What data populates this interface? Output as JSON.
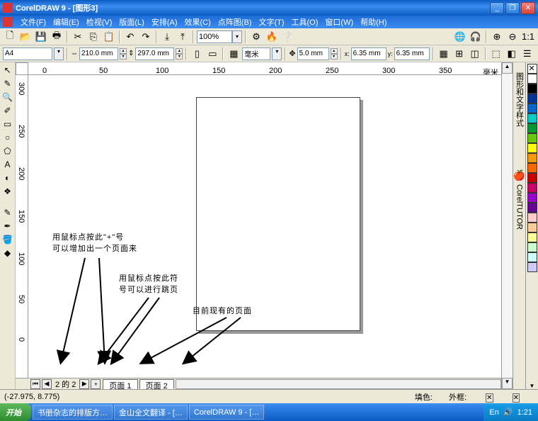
{
  "title": "CorelDRAW 9 - [图形3]",
  "menus": [
    "文件(F)",
    "编辑(E)",
    "检视(V)",
    "版面(L)",
    "安排(A)",
    "效果(C)",
    "点阵图(B)",
    "文字(T)",
    "工具(O)",
    "窗口(W)",
    "帮助(H)"
  ],
  "toolbar1": {
    "zoom_value": "100%"
  },
  "propbar": {
    "paper": "A4",
    "width": "210.0 mm",
    "height": "297.0 mm",
    "unit": "毫米",
    "nudge": "5.0 mm",
    "dup_x": "6.35 mm",
    "dup_y": "6.35 mm"
  },
  "ruler_h_ticks": [
    "0",
    "50",
    "100",
    "150",
    "200",
    "250",
    "300",
    "350"
  ],
  "ruler_h_unit": "毫米",
  "ruler_v_ticks": [
    "300",
    "250",
    "200",
    "150",
    "100",
    "50",
    "0"
  ],
  "annotations": {
    "a1_line1": "用鼠标点按此\"+\"号",
    "a1_line2": "可以增加出一个页面来",
    "a2_line1": "用鼠标点按此符",
    "a2_line2": "号可以进行跳页",
    "a3": "目前现有的页面"
  },
  "page_tabs": {
    "counter": "2 的 2",
    "tab1": "页面  1",
    "tab2": "页面  2"
  },
  "status": {
    "coords": "(-27.975, 8.775)",
    "fill_label": "填色:",
    "outline_label": "外框:"
  },
  "taskbar": {
    "start": "开始",
    "tasks": [
      "书册杂志的排版方…",
      "金山全文翻译 - […",
      "CorelDRAW 9 - […"
    ],
    "time": "1:21"
  },
  "palette_colors": [
    "#ffffff",
    "#000000",
    "#003399",
    "#0066cc",
    "#00cccc",
    "#009933",
    "#66cc00",
    "#ffff00",
    "#ff9900",
    "#ff6600",
    "#cc0000",
    "#cc0066",
    "#9900cc",
    "#660099",
    "#ffcccc",
    "#ffcc99",
    "#ffff99",
    "#ccffcc",
    "#ccffff",
    "#ccccff"
  ]
}
